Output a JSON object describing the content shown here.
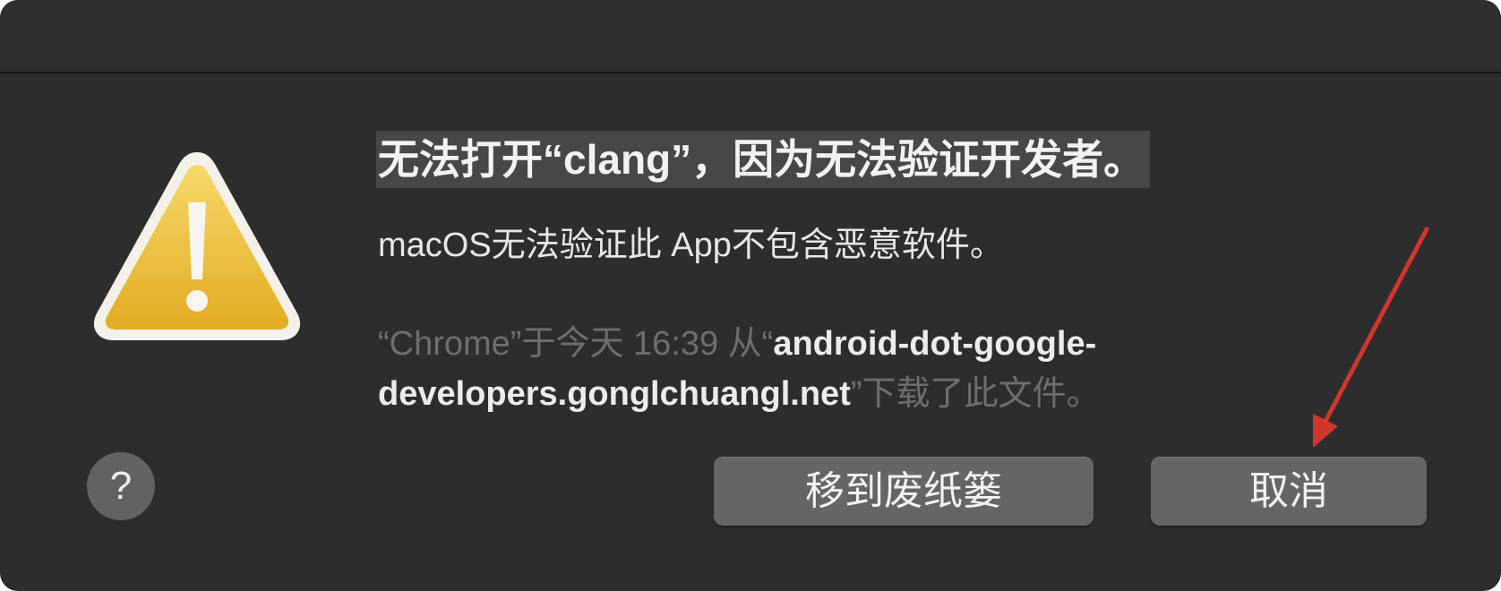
{
  "dialog": {
    "title": "无法打开“clang”，因为无法验证开发者。",
    "subtitle": "macOS无法验证此 App不包含恶意软件。",
    "source": {
      "prefix": "“Chrome”于今天 16:39 从“",
      "url": "android-dot-google-developers.gonglchuangl.net",
      "suffix": "”下载了此文件。"
    },
    "help_label": "?",
    "buttons": {
      "trash": "移到废纸篓",
      "cancel": "取消"
    }
  },
  "icons": {
    "warning": "warning-triangle-icon",
    "annotation": "red-arrow-annotation"
  },
  "colors": {
    "background": "#2d2d2e",
    "warning_fill": "#f0c43c",
    "annotation": "#d0362a"
  }
}
